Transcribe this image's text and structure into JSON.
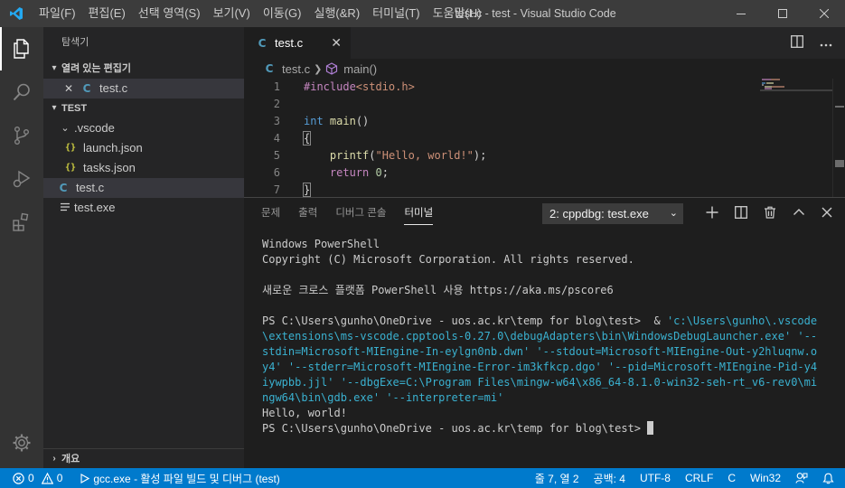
{
  "window": {
    "title": "test.c - test - Visual Studio Code"
  },
  "menu": [
    {
      "label": "파일(F)"
    },
    {
      "label": "편집(E)"
    },
    {
      "label": "선택 영역(S)"
    },
    {
      "label": "보기(V)"
    },
    {
      "label": "이동(G)"
    },
    {
      "label": "실행(&R)"
    },
    {
      "label": "터미널(T)"
    },
    {
      "label": "도움말(H)"
    }
  ],
  "sidebar": {
    "title": "탐색기",
    "open_editors": {
      "label": "열려 있는 편집기",
      "items": [
        {
          "close": "✕",
          "icon": "C",
          "name": "test.c"
        }
      ]
    },
    "workspace": {
      "label": "TEST",
      "folder": ".vscode",
      "folder_files": [
        {
          "icon": "{}",
          "name": "launch.json"
        },
        {
          "icon": "{}",
          "name": "tasks.json"
        }
      ],
      "files": [
        {
          "icon": "C",
          "name": "test.c"
        },
        {
          "name": "test.exe"
        }
      ]
    },
    "outline": {
      "label": "개요"
    }
  },
  "editor": {
    "tab": {
      "icon": "C",
      "label": "test.c",
      "close": "✕"
    },
    "breadcrumb": {
      "file_icon": "C",
      "file": "test.c",
      "sep": "❯",
      "symbol": "main()"
    },
    "line_numbers": [
      "1",
      "2",
      "3",
      "4",
      "5",
      "6",
      "7"
    ],
    "code": {
      "l1_directive": "#include",
      "l1_header": "<stdio.h>",
      "l3_type": "int",
      "l3_fn": "main",
      "l3_parens": "()",
      "l4": "{",
      "l5_fn": "printf",
      "l5_open": "(",
      "l5_str": "\"Hello, world!\"",
      "l5_close": ");",
      "l6_kw": "return",
      "l6_num": "0",
      "l6_semi": ";",
      "l7": "}"
    }
  },
  "panel": {
    "tabs": [
      {
        "label": "문제"
      },
      {
        "label": "출력"
      },
      {
        "label": "디버그 콘솔"
      },
      {
        "label": "터미널"
      }
    ],
    "terminal_selector": "2: cppdbg: test.exe",
    "terminal": {
      "l1": "Windows PowerShell",
      "l2": "Copyright (C) Microsoft Corporation. All rights reserved.",
      "l3": "새로운 크로스 플랫폼 PowerShell 사용 https://aka.ms/pscore6",
      "prompt1": "PS C:\\Users\\gunho\\OneDrive - uos.ac.kr\\temp for blog\\test>  & ",
      "cmd": "'c:\\Users\\gunho\\.vscode\\extensions\\ms-vscode.cpptools-0.27.0\\debugAdapters\\bin\\WindowsDebugLauncher.exe' '--stdin=Microsoft-MIEngine-In-eylgn0nb.dwn' '--stdout=Microsoft-MIEngine-Out-y2hluqnw.oy4' '--stderr=Microsoft-MIEngine-Error-im3kfkcp.dgo' '--pid=Microsoft-MIEngine-Pid-y4iywpbb.jjl' '--dbgExe=C:\\Program Files\\mingw-w64\\x86_64-8.1.0-win32-seh-rt_v6-rev0\\mingw64\\bin\\gdb.exe' '--interpreter=mi'",
      "output": "Hello, world!",
      "prompt2": "PS C:\\Users\\gunho\\OneDrive - uos.ac.kr\\temp for blog\\test> "
    }
  },
  "statusbar": {
    "errors": "0",
    "warnings": "0",
    "task": "gcc.exe - 활성 파일 빌드 및 디버그 (test)",
    "position": "줄 7, 열 2",
    "spaces": "공백: 4",
    "encoding": "UTF-8",
    "eol": "CRLF",
    "language": "C",
    "platform": "Win32"
  },
  "colors": {
    "accent": "#007acc",
    "titlebar": "#3c3c3c",
    "activitybar": "#333333",
    "sidebar": "#252526",
    "editor": "#1e1e1e"
  }
}
